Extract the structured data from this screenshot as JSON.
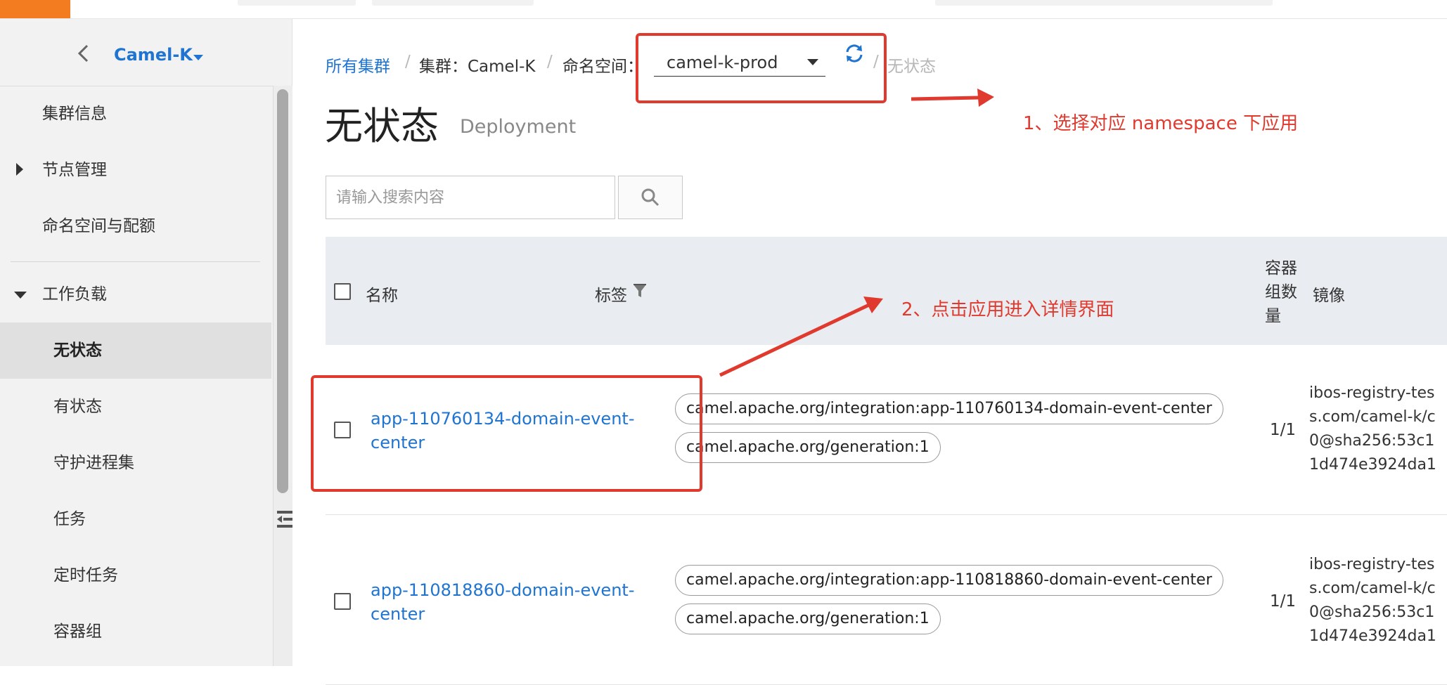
{
  "sidebar": {
    "cluster_name": "Camel-K",
    "items": [
      {
        "label": "集群信息"
      },
      {
        "label": "节点管理"
      },
      {
        "label": "命名空间与配额"
      },
      {
        "label": "工作负载"
      },
      {
        "label": "无状态"
      },
      {
        "label": "有状态"
      },
      {
        "label": "守护进程集"
      },
      {
        "label": "任务"
      },
      {
        "label": "定时任务"
      },
      {
        "label": "容器组"
      }
    ]
  },
  "breadcrumb": {
    "all_clusters": "所有集群",
    "cluster": "集群：Camel-K",
    "namespace_label": "命名空间：",
    "namespace_value": "camel-k-prod",
    "current": "无状态"
  },
  "page": {
    "title": "无状态",
    "subtitle": "Deployment"
  },
  "search": {
    "placeholder": "请输入搜索内容"
  },
  "table": {
    "headers": {
      "name": "名称",
      "labels": "标签",
      "pod_count": "容器组数量",
      "image": "镜像"
    },
    "rows": [
      {
        "name": "app-110760134-domain-event-center",
        "tags": [
          "camel.apache.org/integration:app-110760134-domain-event-center",
          "camel.apache.org/generation:1"
        ],
        "pods": "1/1",
        "image": "ibos-registry-tes\ns.com/camel-k/c\n0@sha256:53c1\n1d474e3924da1"
      },
      {
        "name": "app-110818860-domain-event-center",
        "tags": [
          "camel.apache.org/integration:app-110818860-domain-event-center",
          "camel.apache.org/generation:1"
        ],
        "pods": "1/1",
        "image": "ibos-registry-tes\ns.com/camel-k/c\n0@sha256:53c1\n1d474e3924da1"
      }
    ]
  },
  "annotations": {
    "step1": "1、选择对应 namespace 下应用",
    "step2": "2、点击应用进入详情界面"
  },
  "colors": {
    "accent": "#1f74d1",
    "brand": "#f47c20",
    "annotation": "#e03a2f"
  }
}
